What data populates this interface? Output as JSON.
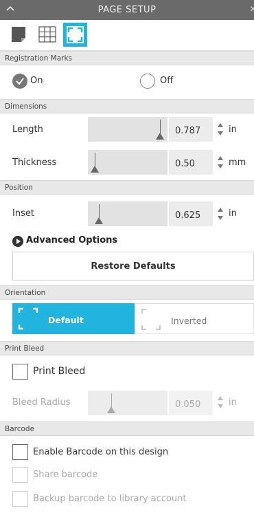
{
  "panel": {
    "title": "PAGE SETUP"
  },
  "icons": {
    "collapse": "chevron-up-icon",
    "close": "close-icon",
    "tab_page": "page-icon",
    "tab_grid": "grid-icon",
    "tab_registration": "registration-marks-icon"
  },
  "colors": {
    "accent": "#20b4de",
    "titlebar": "#6a6a6a",
    "section": "#e8e8e8"
  },
  "registration_marks": {
    "header": "Registration Marks",
    "on_label": "On",
    "off_label": "Off",
    "selected": "On"
  },
  "dimensions": {
    "header": "Dimensions",
    "length": {
      "label": "Length",
      "value": "0.787",
      "unit": "in",
      "slider_fraction": 0.95
    },
    "thickness": {
      "label": "Thickness",
      "value": "0.50",
      "unit": "mm",
      "slider_fraction": 0.04
    }
  },
  "position": {
    "header": "Position",
    "inset": {
      "label": "Inset",
      "value": "0.625",
      "unit": "in",
      "slider_fraction": 0.1
    },
    "advanced_label": "Advanced Options",
    "restore_label": "Restore Defaults"
  },
  "orientation": {
    "header": "Orientation",
    "default_label": "Default",
    "inverted_label": "Inverted",
    "selected": "Default"
  },
  "print_bleed": {
    "header": "Print Bleed",
    "checkbox_label": "Print Bleed",
    "checked": false,
    "bleed_radius": {
      "label": "Bleed Radius",
      "value": "0.050",
      "unit": "in",
      "slider_fraction": 0.27
    }
  },
  "barcode": {
    "header": "Barcode",
    "enable_label": "Enable Barcode on this design",
    "share_label": "Share barcode",
    "backup_label": "Backup barcode to library account"
  }
}
